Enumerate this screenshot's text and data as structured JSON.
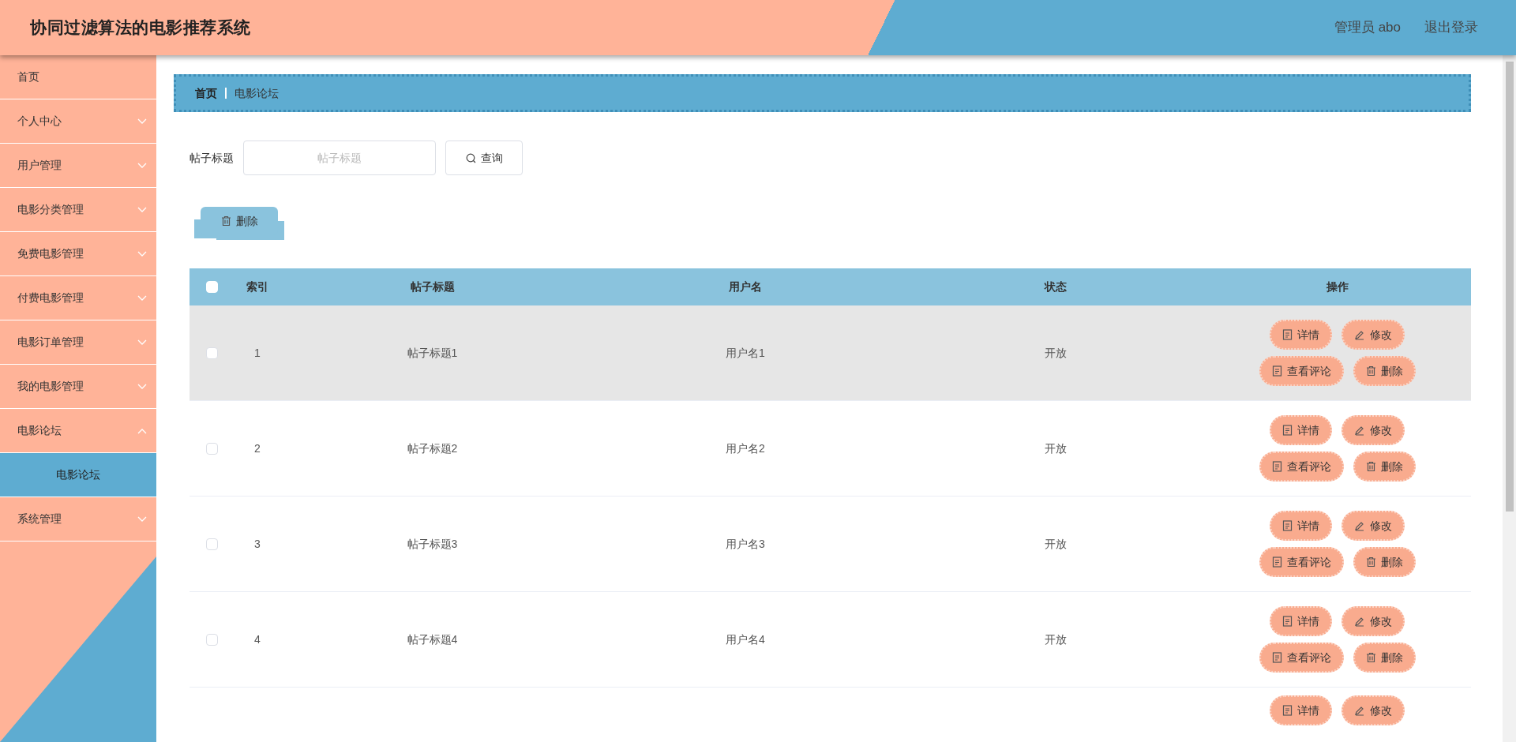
{
  "header": {
    "title": "协同过滤算法的电影推荐系统",
    "user": "管理员 abo",
    "logout": "退出登录"
  },
  "sidebar": {
    "items": [
      {
        "label": "首页",
        "kind": "link"
      },
      {
        "label": "个人中心",
        "kind": "menu",
        "expanded": false
      },
      {
        "label": "用户管理",
        "kind": "menu",
        "expanded": false
      },
      {
        "label": "电影分类管理",
        "kind": "menu",
        "expanded": false
      },
      {
        "label": "免费电影管理",
        "kind": "menu",
        "expanded": false
      },
      {
        "label": "付费电影管理",
        "kind": "menu",
        "expanded": false
      },
      {
        "label": "电影订单管理",
        "kind": "menu",
        "expanded": false
      },
      {
        "label": "我的电影管理",
        "kind": "menu",
        "expanded": false
      },
      {
        "label": "电影论坛",
        "kind": "menu",
        "expanded": true,
        "children": [
          {
            "label": "电影论坛",
            "selected": true
          }
        ]
      },
      {
        "label": "系统管理",
        "kind": "menu",
        "expanded": false
      }
    ]
  },
  "breadcrumb": [
    "首页",
    "电影论坛"
  ],
  "search": {
    "label": "帖子标题",
    "placeholder": "帖子标题",
    "button": "查询"
  },
  "toolbar": {
    "delete_button": "删除"
  },
  "table": {
    "select_all_checked": false,
    "columns": [
      "索引",
      "帖子标题",
      "用户名",
      "状态",
      "操作"
    ],
    "rows": [
      {
        "index": "1",
        "title": "帖子标题1",
        "user": "用户名1",
        "status": "开放",
        "checked": false,
        "highlighted": true,
        "actions": [
          {
            "label": "详情",
            "kind": "doc"
          },
          {
            "label": "修改",
            "kind": "pen"
          },
          {
            "label": "查看评论",
            "kind": "doc"
          },
          {
            "label": "删除",
            "kind": "trash"
          }
        ]
      },
      {
        "index": "2",
        "title": "帖子标题2",
        "user": "用户名2",
        "status": "开放",
        "checked": false,
        "highlighted": false,
        "actions": [
          {
            "label": "详情",
            "kind": "doc"
          },
          {
            "label": "修改",
            "kind": "pen"
          },
          {
            "label": "查看评论",
            "kind": "doc"
          },
          {
            "label": "删除",
            "kind": "trash"
          }
        ]
      },
      {
        "index": "3",
        "title": "帖子标题3",
        "user": "用户名3",
        "status": "开放",
        "checked": false,
        "highlighted": false,
        "actions": [
          {
            "label": "详情",
            "kind": "doc"
          },
          {
            "label": "修改",
            "kind": "pen"
          },
          {
            "label": "查看评论",
            "kind": "doc"
          },
          {
            "label": "删除",
            "kind": "trash"
          }
        ]
      },
      {
        "index": "4",
        "title": "帖子标题4",
        "user": "用户名4",
        "status": "开放",
        "checked": false,
        "highlighted": false,
        "actions": [
          {
            "label": "详情",
            "kind": "doc"
          },
          {
            "label": "修改",
            "kind": "pen"
          },
          {
            "label": "查看评论",
            "kind": "doc"
          },
          {
            "label": "删除",
            "kind": "trash"
          }
        ]
      }
    ],
    "partial_row": {
      "actions": [
        {
          "label": "详情",
          "kind": "doc"
        },
        {
          "label": "修改",
          "kind": "pen"
        }
      ]
    }
  }
}
